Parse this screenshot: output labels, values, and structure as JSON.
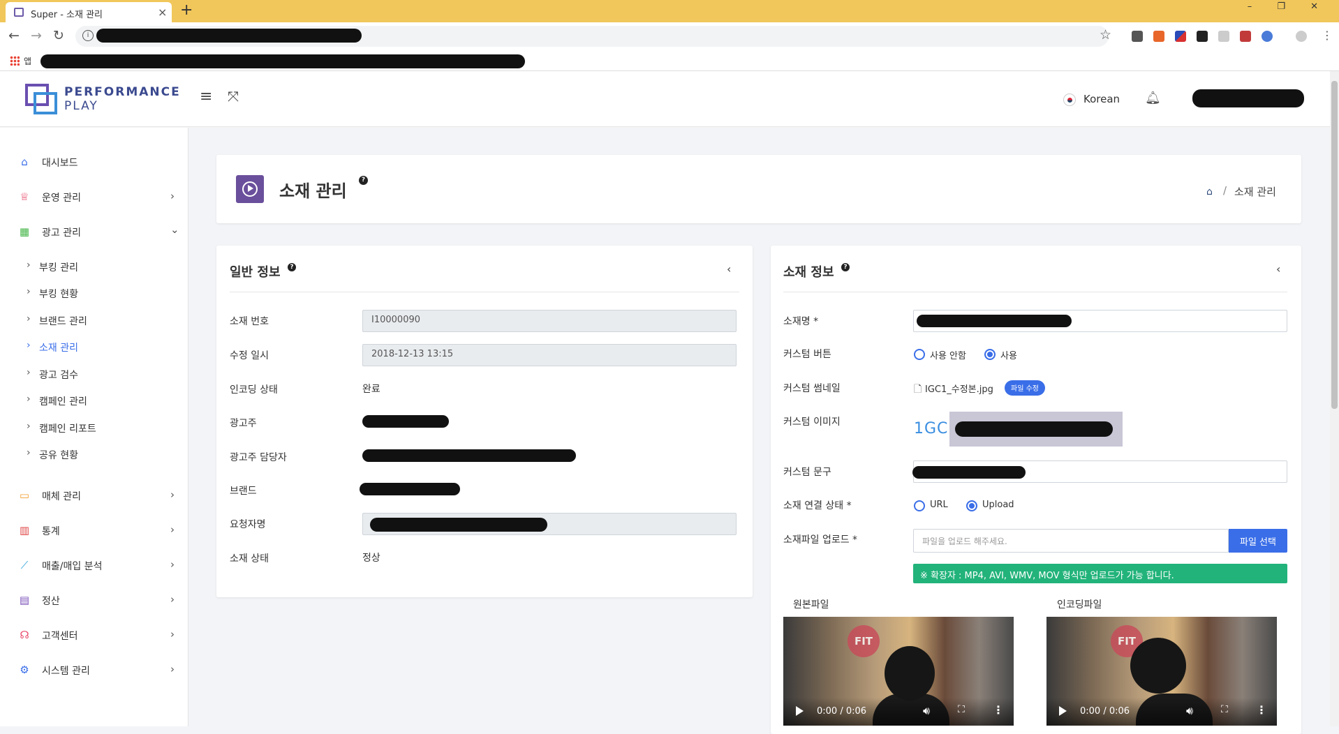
{
  "browser": {
    "tab_title": "Super - 소재 관리",
    "new_tab": "+",
    "window_controls": "– ❐ ✕",
    "bookmarks_apps_label": "앱"
  },
  "header": {
    "logo_line1": "PERFORMANCE",
    "logo_line2": "PLAY",
    "language": "Korean"
  },
  "sidebar": {
    "items": [
      {
        "label": "대시보드",
        "icon": "home-icon",
        "color": "#3a6ee8"
      },
      {
        "label": "운영 관리",
        "icon": "crown-icon",
        "color": "#e84a6a"
      },
      {
        "label": "광고 관리",
        "icon": "grid-icon",
        "color": "#44b549"
      },
      {
        "label": "매체 관리",
        "icon": "monitor-icon",
        "color": "#f0a030"
      },
      {
        "label": "통계",
        "icon": "bar-chart-icon",
        "color": "#e04848"
      },
      {
        "label": "매출/매입 분석",
        "icon": "line-chart-icon",
        "color": "#2aa0d8"
      },
      {
        "label": "정산",
        "icon": "calculator-icon",
        "color": "#7a4fb8"
      },
      {
        "label": "고객센터",
        "icon": "headset-icon",
        "color": "#e84a6a"
      },
      {
        "label": "시스템 관리",
        "icon": "gear-icon",
        "color": "#3a6ee8"
      }
    ],
    "sub_items": [
      {
        "label": "부킹 관리"
      },
      {
        "label": "부킹 현황"
      },
      {
        "label": "브랜드 관리"
      },
      {
        "label": "소재 관리"
      },
      {
        "label": "광고 검수"
      },
      {
        "label": "캠페인 관리"
      },
      {
        "label": "캠페인 리포트"
      },
      {
        "label": "공유 현황"
      }
    ]
  },
  "page": {
    "title": "소재 관리",
    "breadcrumb_current": "소재 관리"
  },
  "general": {
    "title": "일반 정보",
    "fields": [
      {
        "label": "소재 번호",
        "value": "I10000090"
      },
      {
        "label": "수정 일시",
        "value": "2018-12-13 13:15"
      },
      {
        "label": "인코딩 상태",
        "value": "완료"
      },
      {
        "label": "광고주",
        "value": ""
      },
      {
        "label": "광고주 담당자",
        "value": ""
      },
      {
        "label": "브랜드",
        "value": ""
      },
      {
        "label": "요청자명",
        "value": ""
      },
      {
        "label": "소재 상태",
        "value": "정상"
      }
    ]
  },
  "material": {
    "title": "소재 정보",
    "name_label": "소재명 *",
    "custom_button_label": "커스텀 버튼",
    "custom_button_options": [
      "사용 안함",
      "사용"
    ],
    "custom_button_selected": "사용",
    "thumbnail_label": "커스텀 썸네일",
    "thumbnail_file": "IGC1_수정본.jpg",
    "thumbnail_edit_button": "파일 수정",
    "image_label": "커스텀 이미지",
    "image_logo_text": "1GC",
    "phrase_label": "커스텀 문구",
    "link_status_label": "소재 연결 상태 *",
    "link_options": [
      "URL",
      "Upload"
    ],
    "link_selected": "Upload",
    "upload_label": "소재파일 업로드 *",
    "upload_placeholder": "파일을 업로드 해주세요.",
    "upload_button": "파일 선택",
    "notice": "※ 확장자 : MP4, AVI, WMV, MOV 형식만 업로드가 가능 합니다.",
    "original_label": "원본파일",
    "encoded_label": "인코딩파일",
    "video_time": "0:00 / 0:06",
    "video_logo": "FIT"
  }
}
